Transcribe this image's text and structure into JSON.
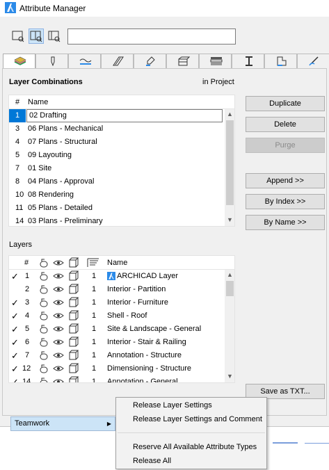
{
  "window": {
    "title": "Attribute Manager",
    "accent": "#2b8ae8"
  },
  "toolbar": {
    "view_buttons": [
      {
        "icon": "list-view-icon"
      },
      {
        "icon": "split-view-icon",
        "active": true
      },
      {
        "icon": "detail-view-icon"
      }
    ],
    "search": {
      "value": "",
      "placeholder": ""
    }
  },
  "tabs": [
    {
      "icon": "layers-icon",
      "active": true
    },
    {
      "icon": "pen-icon"
    },
    {
      "icon": "line-type-icon"
    },
    {
      "icon": "fill-icon"
    },
    {
      "icon": "surface-icon"
    },
    {
      "icon": "building-material-icon"
    },
    {
      "icon": "composite-icon"
    },
    {
      "icon": "profile-icon"
    },
    {
      "icon": "zone-category-icon"
    },
    {
      "icon": "mep-icon"
    }
  ],
  "combinations": {
    "title": "Layer Combinations",
    "scope": "in Project",
    "columns": [
      "#",
      "Name"
    ],
    "rows": [
      {
        "num": "1",
        "name": "02 Drafting",
        "selected": true
      },
      {
        "num": "3",
        "name": "06 Plans - Mechanical"
      },
      {
        "num": "4",
        "name": "07 Plans - Structural"
      },
      {
        "num": "5",
        "name": "09 Layouting"
      },
      {
        "num": "7",
        "name": "01 Site"
      },
      {
        "num": "8",
        "name": "04 Plans - Approval"
      },
      {
        "num": "10",
        "name": "08 Rendering"
      },
      {
        "num": "11",
        "name": "05 Plans - Detailed"
      },
      {
        "num": "14",
        "name": "03 Plans - Preliminary"
      }
    ]
  },
  "buttons": {
    "duplicate": "Duplicate",
    "delete": "Delete",
    "purge": "Purge",
    "append": "Append >>",
    "by_index": "By Index >>",
    "by_name": "By Name >>",
    "save_txt": "Save as TXT..."
  },
  "layers": {
    "title": "Layers",
    "columns": {
      "num": "#",
      "name": "Name"
    },
    "rows": [
      {
        "check": true,
        "num": "1",
        "value": "1",
        "name": "ARCHICAD Layer",
        "app_icon": true
      },
      {
        "check": false,
        "num": "2",
        "value": "1",
        "name": "Interior - Partition"
      },
      {
        "check": true,
        "num": "3",
        "value": "1",
        "name": "Interior - Furniture"
      },
      {
        "check": true,
        "num": "4",
        "value": "1",
        "name": "Shell - Roof"
      },
      {
        "check": true,
        "num": "5",
        "value": "1",
        "name": "Site & Landscape - General"
      },
      {
        "check": true,
        "num": "6",
        "value": "1",
        "name": "Interior - Stair & Railing"
      },
      {
        "check": true,
        "num": "7",
        "value": "1",
        "name": "Annotation - Structure"
      },
      {
        "check": true,
        "num": "12",
        "value": "1",
        "name": "Dimensioning - Structure"
      },
      {
        "check": true,
        "num": "14",
        "value": "1",
        "name": "Annotation - General"
      }
    ]
  },
  "teamwork": {
    "label": "Teamwork"
  },
  "context_menu": {
    "items": [
      "Release Layer Settings",
      "Release Layer Settings and Comment",
      "Reserve All Available Attribute Types",
      "Release All"
    ]
  }
}
